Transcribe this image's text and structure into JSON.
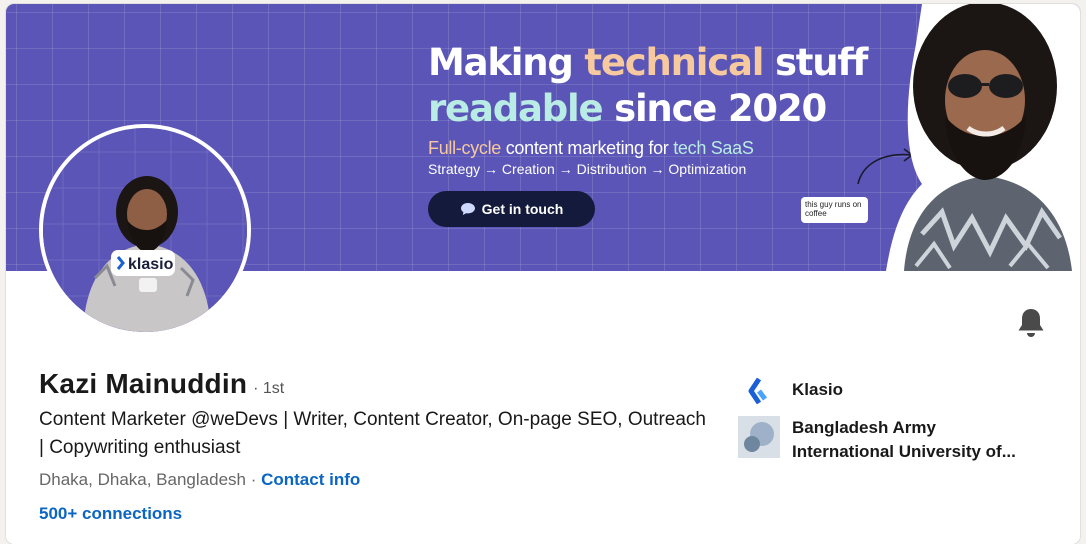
{
  "banner": {
    "headline_line1_a": "Making ",
    "headline_line1_b": "technical",
    "headline_line1_c": " stuff",
    "headline_line2_a": "readable",
    "headline_line2_b": " since 2020",
    "sub_a": "Full-cycle",
    "sub_b": " content marketing for ",
    "sub_c": "tech SaaS",
    "steps": "Strategy → Creation → Distribution → Optimization",
    "cta_label": "Get in touch",
    "coffee_note": "this guy runs on coffee",
    "colors": {
      "background": "#5a55b6",
      "accent_orange": "#f7c99f",
      "accent_mint": "#b9ece4",
      "cta": "#141a3c"
    }
  },
  "avatar": {
    "shirt_text": "klasio"
  },
  "profile": {
    "name": "Kazi Mainuddin",
    "degree": "· 1st",
    "headline": "Content Marketer @weDevs | Writer, Content Creator, On-page SEO, Outreach | Copywriting enthusiast",
    "location": "Dhaka, Dhaka, Bangladesh",
    "separator": " · ",
    "contact_label": "Contact info",
    "connections": "500+ connections"
  },
  "actions": {
    "bell_icon": "bell-icon"
  },
  "organizations": [
    {
      "name": "Klasio",
      "icon": "klasio-logo"
    },
    {
      "name": "Bangladesh Army International University of...",
      "icon": "university-logo"
    }
  ]
}
